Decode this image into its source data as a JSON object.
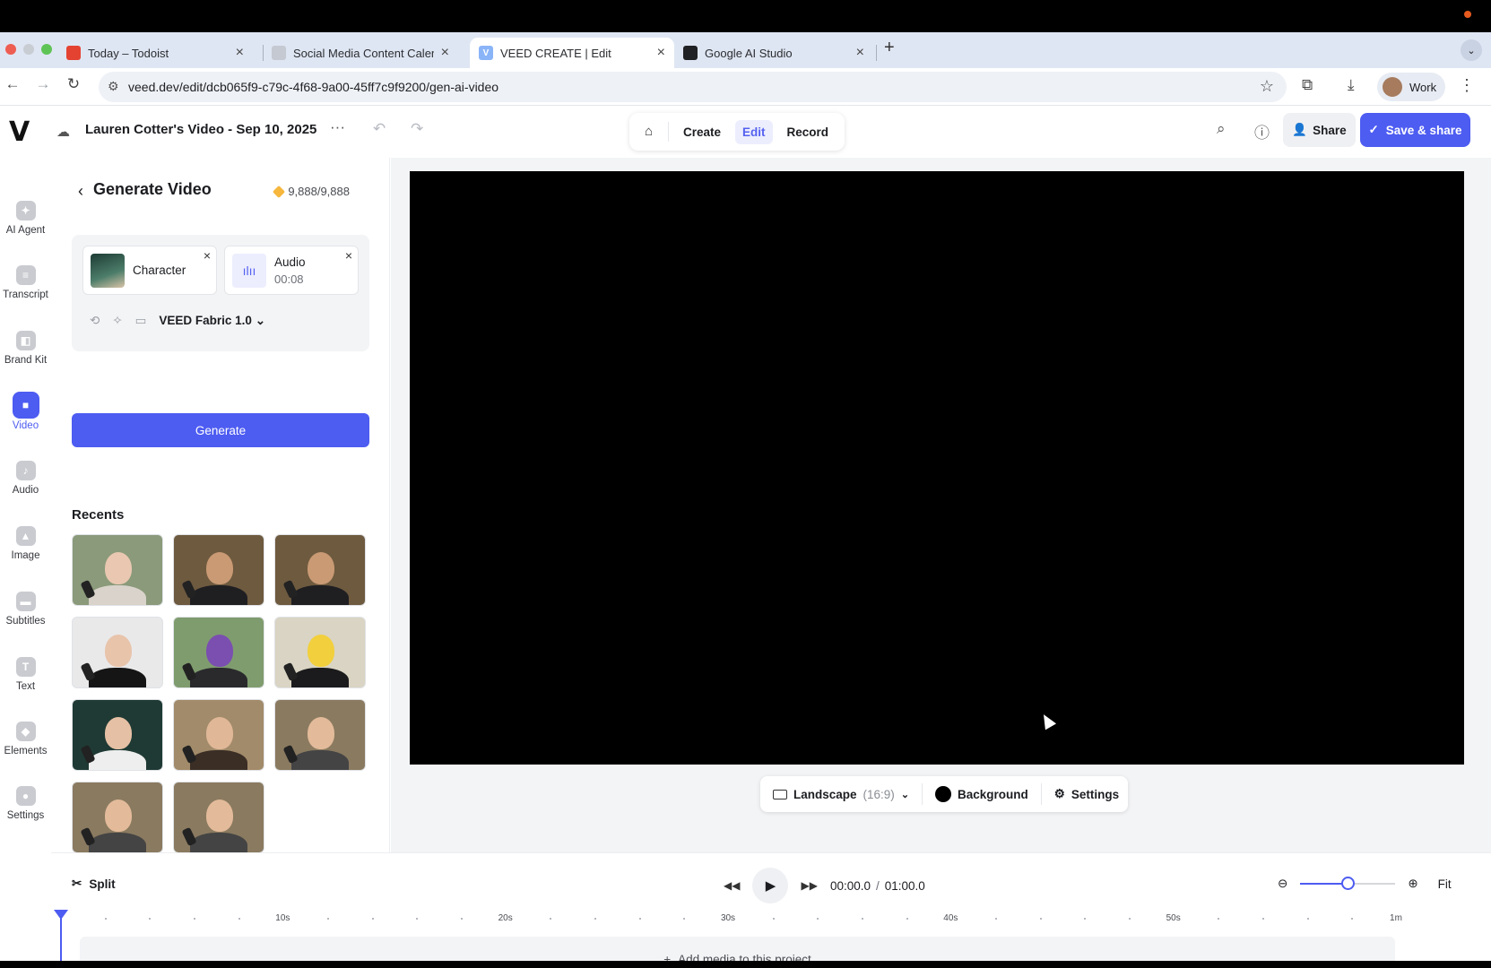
{
  "browser": {
    "tabs": [
      {
        "title": "Today – Todoist",
        "fav_color": "#e44332",
        "active": false
      },
      {
        "title": "Social Media Content Calend…",
        "fav_color": "#c5c9d1",
        "active": false
      },
      {
        "title": "VEED CREATE | Edit",
        "fav_color": "#8ab4f8",
        "active": true
      },
      {
        "title": "Google AI Studio",
        "fav_color": "#202124",
        "active": false
      }
    ],
    "url": "veed.dev/edit/dcb065f9-c79c-4f68-9a00-45ff7c9f9200/gen-ai-video",
    "profile_label": "Work"
  },
  "header": {
    "project_title": "Lauren Cotter's Video - Sep 10, 2025",
    "modes": [
      "Create",
      "Edit",
      "Record"
    ],
    "active_mode": "Edit",
    "share_label": "Share",
    "save_label": "Save & share"
  },
  "rail": [
    {
      "label": "AI Agent",
      "icon": "sparkle-icon",
      "active": false
    },
    {
      "label": "Transcript",
      "icon": "transcript-icon",
      "active": false
    },
    {
      "label": "Brand Kit",
      "icon": "brand-kit-icon",
      "active": false
    },
    {
      "label": "Video",
      "icon": "video-camera-icon",
      "active": true
    },
    {
      "label": "Audio",
      "icon": "music-note-icon",
      "active": false
    },
    {
      "label": "Image",
      "icon": "image-icon",
      "active": false
    },
    {
      "label": "Subtitles",
      "icon": "subtitles-icon",
      "active": false
    },
    {
      "label": "Text",
      "icon": "text-icon",
      "active": false
    },
    {
      "label": "Elements",
      "icon": "elements-icon",
      "active": false
    },
    {
      "label": "Settings",
      "icon": "settings-icon",
      "active": false
    }
  ],
  "panel": {
    "title": "Generate Video",
    "credits": "9,888/9,888",
    "character_label": "Character",
    "audio_label": "Audio",
    "audio_duration": "00:08",
    "model": "VEED Fabric 1.0",
    "generate_label": "Generate",
    "recents_label": "Recents",
    "recents": [
      {
        "bg": "#8a9a7a",
        "skin": "#e9c7b0",
        "cloth": "#d9d3cb"
      },
      {
        "bg": "#6e5a3f",
        "skin": "#c99a74",
        "cloth": "#1f1f22"
      },
      {
        "bg": "#6e5a3f",
        "skin": "#c99a74",
        "cloth": "#1f1f22"
      },
      {
        "bg": "#e9e9ea",
        "skin": "#e8c4ab",
        "cloth": "#151516"
      },
      {
        "bg": "#7f9c6e",
        "skin": "#7a4fb0",
        "cloth": "#2a2a2d"
      },
      {
        "bg": "#d9d4c3",
        "skin": "#f2cf3c",
        "cloth": "#1b1b1d"
      },
      {
        "bg": "#1f3a34",
        "skin": "#e5c0a5",
        "cloth": "#eeeeee"
      },
      {
        "bg": "#a28b6a",
        "skin": "#e0b898",
        "cloth": "#3a2e25"
      },
      {
        "bg": "#8a7a60",
        "skin": "#e3bb9a",
        "cloth": "#444444"
      },
      {
        "bg": "#8a7a60",
        "skin": "#e3bb9a",
        "cloth": "#444444"
      },
      {
        "bg": "#8a7a60",
        "skin": "#e3bb9a",
        "cloth": "#444444"
      }
    ]
  },
  "canvas": {
    "aspect_label": "Landscape",
    "aspect_ratio": "(16:9)",
    "background_label": "Background",
    "settings_label": "Settings"
  },
  "timeline": {
    "split_label": "Split",
    "current_time": "00:00.0",
    "total_time": "01:00.0",
    "fit_label": "Fit",
    "zoom_level": 0.5,
    "ruler_labels": [
      "10s",
      "20s",
      "30s",
      "40s",
      "50s",
      "1m"
    ],
    "add_media_label": "Add media to this project"
  }
}
